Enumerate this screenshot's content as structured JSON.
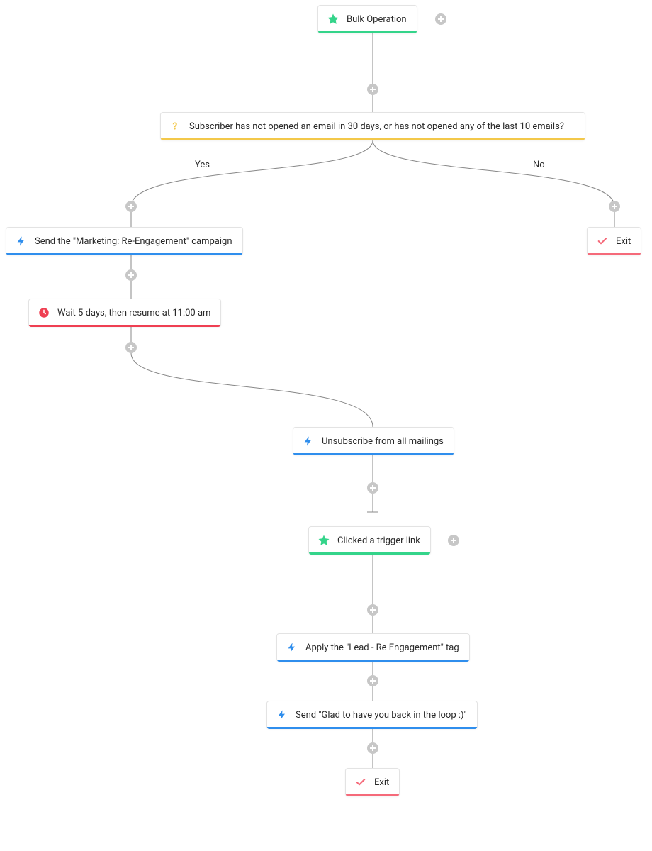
{
  "nodes": {
    "bulk_op": "Bulk Operation",
    "condition": "Subscriber has not opened an email in 30 days, or has not opened any of the last 10 emails?",
    "send_reengage": "Send the \"Marketing: Re-Engagement\" campaign",
    "exit_no": "Exit",
    "wait": "Wait 5 days, then resume at 11:00 am",
    "unsubscribe": "Unsubscribe from all mailings",
    "trigger_link": "Clicked a trigger link",
    "apply_tag": "Apply the \"Lead - Re Engagement\" tag",
    "send_glad": "Send \"Glad to have you back in the loop :)\"",
    "exit_final": "Exit"
  },
  "branches": {
    "yes": "Yes",
    "no": "No"
  },
  "colors": {
    "green": "#34d48a",
    "yellow": "#f3c84a",
    "blue": "#2f8eed",
    "red": "#ef3f52",
    "pink": "#f56a7a",
    "plus": "#c7c7c7"
  }
}
